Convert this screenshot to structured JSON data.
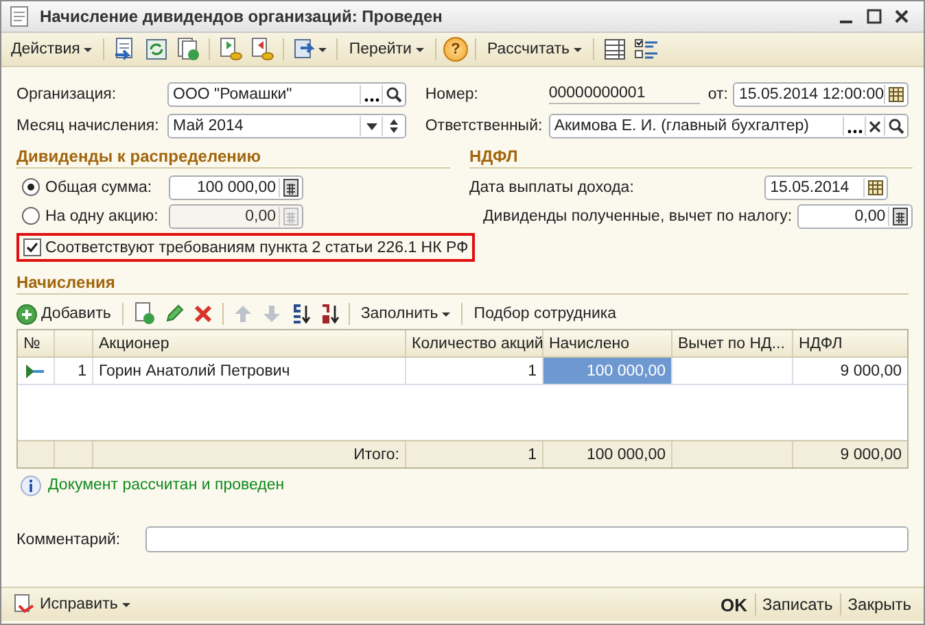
{
  "window": {
    "title": "Начисление дивидендов организаций: Проведен"
  },
  "toolbar": {
    "actions": "Действия",
    "goto": "Перейти",
    "help": "?",
    "calculate": "Рассчитать"
  },
  "header": {
    "organization": {
      "label": "Организация:",
      "value": "ООО \"Ромашки\""
    },
    "month": {
      "label": "Месяц начисления:",
      "value": "Май 2014"
    },
    "number": {
      "label": "Номер:",
      "value": "00000000001"
    },
    "date": {
      "label": "от:",
      "value": "15.05.2014 12:00:00"
    },
    "responsible": {
      "label": "Ответственный:",
      "value": "Акимова Е. И. (главный бухгалтер)"
    }
  },
  "dividends": {
    "title": "Дивиденды к распределению",
    "options": [
      {
        "label": "Общая сумма:",
        "value": "100 000,00",
        "selected": true,
        "disabled": false
      },
      {
        "label": "На одну акцию:",
        "value": "0,00",
        "selected": false,
        "disabled": true
      }
    ],
    "compliance": {
      "label": "Соответствуют требованиям пункта 2 статьи 226.1 НК РФ",
      "checked": true,
      "highlighted": true
    }
  },
  "ndfl": {
    "title": "НДФЛ",
    "pay_date": {
      "label": "Дата выплаты дохода:",
      "value": "15.05.2014"
    },
    "deduction": {
      "label": "Дивиденды полученные, вычет по налогу:",
      "value": "0,00"
    }
  },
  "accruals": {
    "title": "Начисления",
    "add": "Добавить",
    "fill": "Заполнить",
    "pick": "Подбор сотрудника",
    "columns": [
      "№",
      "",
      "Акционер",
      "Количество акций",
      "Начислено",
      "Вычет по НД...",
      "НДФЛ"
    ],
    "rows": [
      {
        "current": true,
        "cells": [
          {
            "text": null,
            "selected": false
          },
          {
            "text": "1",
            "selected": false
          },
          {
            "text": "Горин Анатолий Петрович",
            "selected": false
          },
          {
            "text": "1",
            "selected": false
          },
          {
            "text": "100 000,00",
            "selected": true
          },
          {
            "text": null,
            "selected": false
          },
          {
            "text": "9 000,00",
            "selected": false
          }
        ]
      }
    ],
    "totals": {
      "label": "Итого:",
      "quantity": "1",
      "accrued": "100 000,00",
      "ndfl": "9 000,00"
    }
  },
  "status": "Документ рассчитан и проведен",
  "comment": {
    "label": "Комментарий:"
  },
  "footer": {
    "fix": "Исправить",
    "buttons": [
      {
        "label": "OK",
        "default": true
      },
      {
        "label": "Записать",
        "default": false
      },
      {
        "label": "Закрыть",
        "default": false
      }
    ]
  }
}
